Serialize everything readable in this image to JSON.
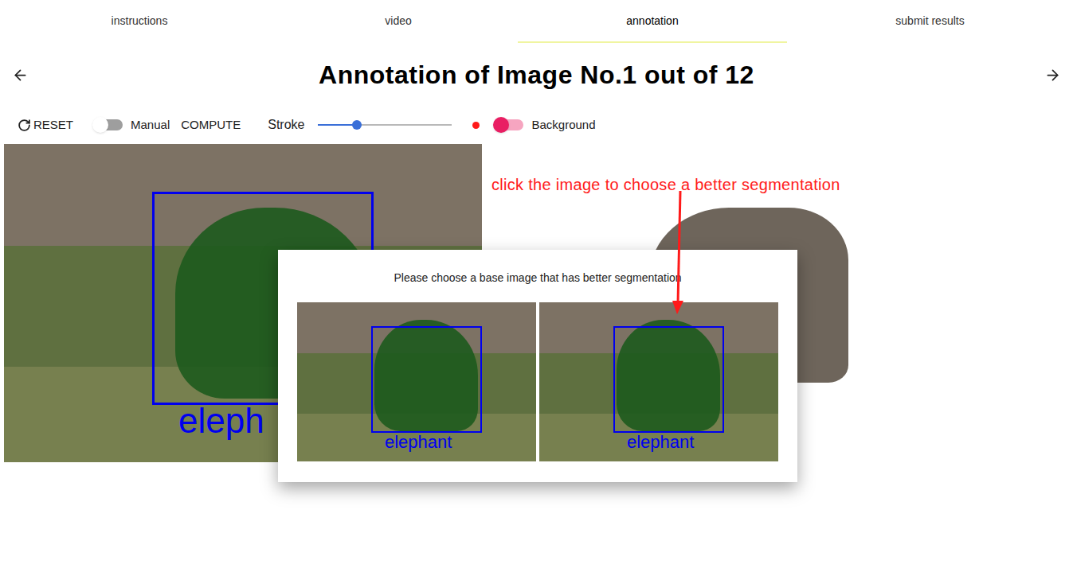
{
  "tabs": [
    {
      "label": "instructions",
      "selected": false
    },
    {
      "label": "video",
      "selected": false
    },
    {
      "label": "annotation",
      "selected": true
    },
    {
      "label": "submit results",
      "selected": false
    }
  ],
  "title": "Annotation of Image No.1 out of 12",
  "toolbar": {
    "reset": "RESET",
    "manual": {
      "label": "Manual",
      "on": false
    },
    "compute": "COMPUTE",
    "stroke": {
      "label": "Stroke",
      "level": 0.29
    },
    "brush": {
      "label": "Background",
      "on": true
    }
  },
  "main_image": {
    "label": "eleph"
  },
  "hint": "click the image to choose a better segmentation",
  "dialog": {
    "prompt": "Please choose a base image that has better segmentation",
    "options": [
      {
        "label": "elephant"
      },
      {
        "label": "elephant"
      }
    ]
  }
}
